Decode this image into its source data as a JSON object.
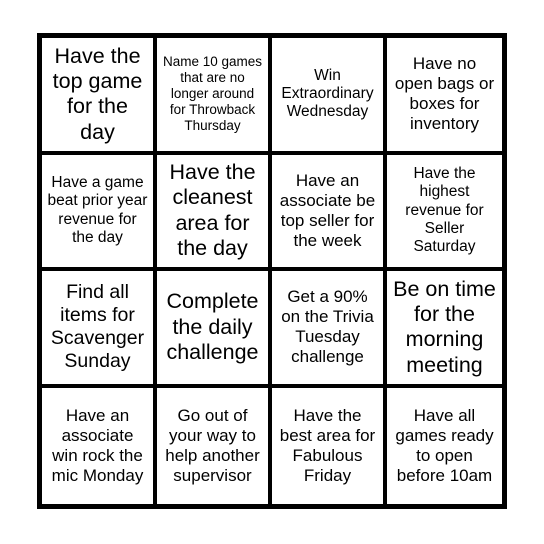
{
  "card": {
    "type": "bingo-card",
    "rows": 4,
    "columns": 4,
    "border_color": "#000000",
    "cell_background": "#ffffff",
    "text_color": "#000000",
    "cells": [
      {
        "id": "r1c1",
        "text": "Have the top game for the day",
        "size": "xl"
      },
      {
        "id": "r1c2",
        "text": "Name 10 games that are no longer around for Throwback Thursday",
        "size": "xs"
      },
      {
        "id": "r1c3",
        "text": "Win Extraordinary Wednesday",
        "size": "sm"
      },
      {
        "id": "r1c4",
        "text": "Have no open bags or boxes for inventory",
        "size": "md"
      },
      {
        "id": "r2c1",
        "text": "Have a game beat prior year revenue for the day",
        "size": "sm"
      },
      {
        "id": "r2c2",
        "text": "Have the cleanest area for the day",
        "size": "xl"
      },
      {
        "id": "r2c3",
        "text": "Have an associate be top seller for the week",
        "size": "md"
      },
      {
        "id": "r2c4",
        "text": "Have the highest revenue for Seller Saturday",
        "size": "sm"
      },
      {
        "id": "r3c1",
        "text": "Find all items for Scavenger Sunday",
        "size": "lg"
      },
      {
        "id": "r3c2",
        "text": "Complete the daily challenge",
        "size": "xl"
      },
      {
        "id": "r3c3",
        "text": "Get a 90% on the Trivia Tuesday challenge",
        "size": "md"
      },
      {
        "id": "r3c4",
        "text": "Be on time for the morning meeting",
        "size": "xl"
      },
      {
        "id": "r4c1",
        "text": "Have an associate win rock the mic Monday",
        "size": "md"
      },
      {
        "id": "r4c2",
        "text": "Go out of your way to help another supervisor",
        "size": "md"
      },
      {
        "id": "r4c3",
        "text": "Have the best area for Fabulous Friday",
        "size": "md"
      },
      {
        "id": "r4c4",
        "text": "Have all games ready to open before 10am",
        "size": "md"
      }
    ]
  }
}
